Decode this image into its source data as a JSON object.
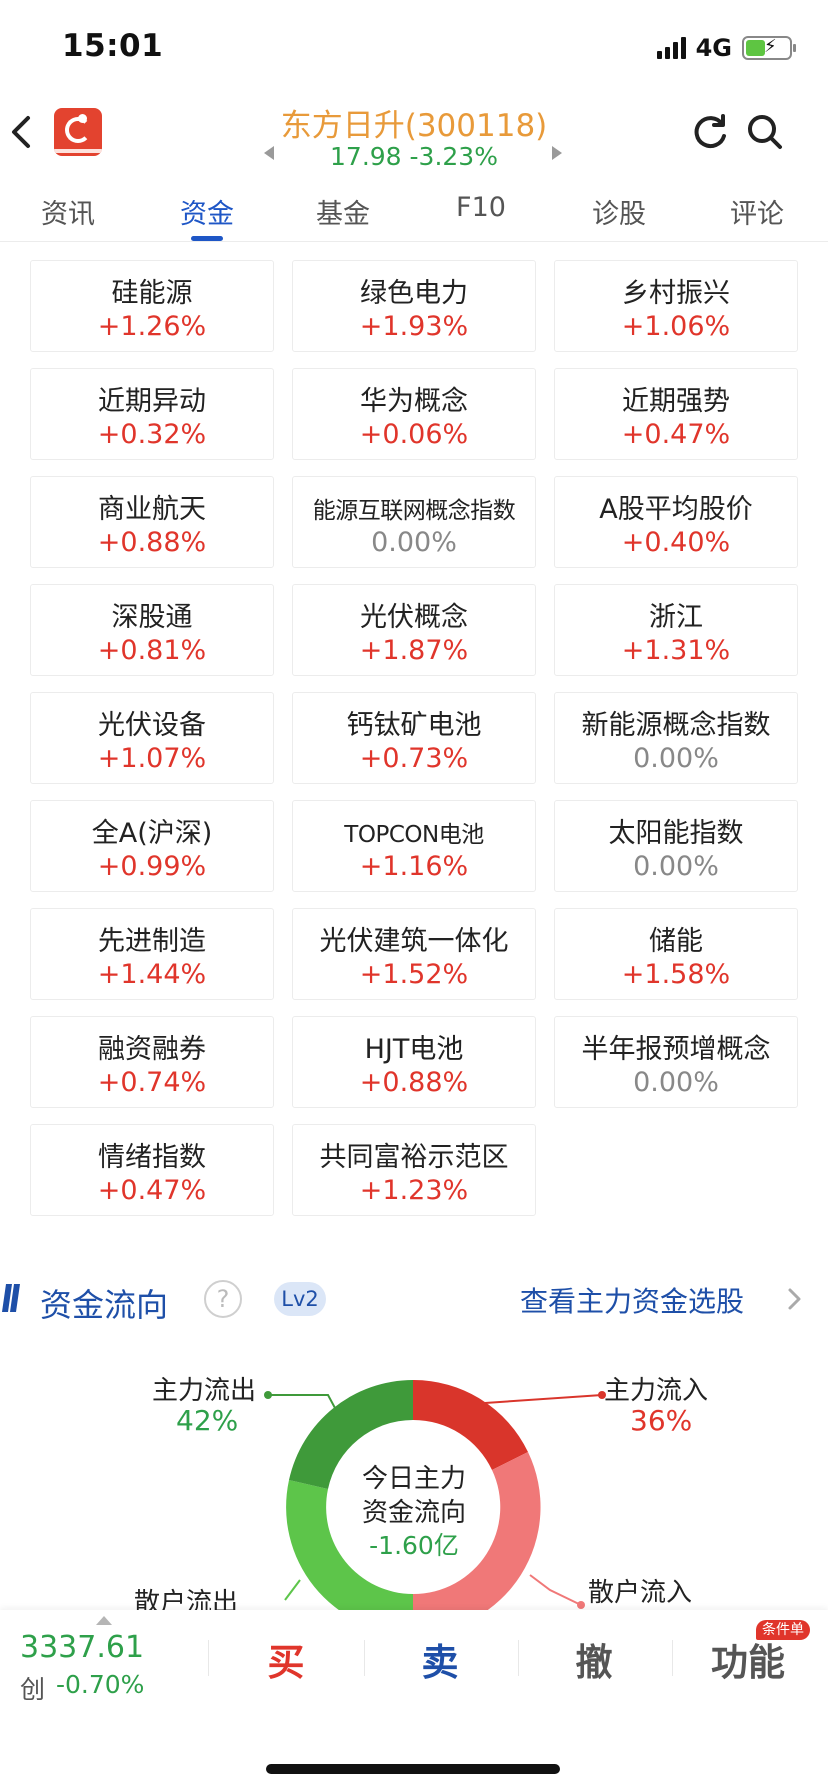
{
  "status_bar": {
    "time": "15:01",
    "network": "4G"
  },
  "header": {
    "stock_title": "东方日升(300118)",
    "stock_quote": "17.98  -3.23%",
    "colors": {
      "title": "#e89a3a",
      "quote": "#2ea04a"
    }
  },
  "tabs": [
    {
      "label": "资讯",
      "active": false
    },
    {
      "label": "资金",
      "active": true
    },
    {
      "label": "基金",
      "active": false
    },
    {
      "label": "F10",
      "active": false
    },
    {
      "label": "诊股",
      "active": false
    },
    {
      "label": "评论",
      "active": false
    }
  ],
  "concepts": [
    {
      "name": "硅能源",
      "change": "+1.26%"
    },
    {
      "name": "绿色电力",
      "change": "+1.93%"
    },
    {
      "name": "乡村振兴",
      "change": "+1.06%"
    },
    {
      "name": "近期异动",
      "change": "+0.32%"
    },
    {
      "name": "华为概念",
      "change": "+0.06%"
    },
    {
      "name": "近期强势",
      "change": "+0.47%"
    },
    {
      "name": "商业航天",
      "change": "+0.88%"
    },
    {
      "name": "能源互联网概念指数",
      "change": "0.00%"
    },
    {
      "name": "A股平均股价",
      "change": "+0.40%"
    },
    {
      "name": "深股通",
      "change": "+0.81%"
    },
    {
      "name": "光伏概念",
      "change": "+1.87%"
    },
    {
      "name": "浙江",
      "change": "+1.31%"
    },
    {
      "name": "光伏设备",
      "change": "+1.07%"
    },
    {
      "name": "钙钛矿电池",
      "change": "+0.73%"
    },
    {
      "name": "新能源概念指数",
      "change": "0.00%"
    },
    {
      "name": "全A(沪深)",
      "change": "+0.99%"
    },
    {
      "name": "TOPCON电池",
      "change": "+1.16%"
    },
    {
      "name": "太阳能指数",
      "change": "0.00%"
    },
    {
      "name": "先进制造",
      "change": "+1.44%"
    },
    {
      "name": "光伏建筑一体化",
      "change": "+1.52%"
    },
    {
      "name": "储能",
      "change": "+1.58%"
    },
    {
      "name": "融资融券",
      "change": "+0.74%"
    },
    {
      "name": "HJT电池",
      "change": "+0.88%"
    },
    {
      "name": "半年报预增概念",
      "change": "0.00%"
    },
    {
      "name": "情绪指数",
      "change": "+0.47%"
    },
    {
      "name": "共同富裕示范区",
      "change": "+1.23%"
    }
  ],
  "money_flow": {
    "title": "资金流向",
    "help_symbol": "?",
    "level_badge": "Lv2",
    "link": "查看主力资金选股",
    "center": {
      "line1": "今日主力",
      "line2": "资金流向",
      "value": "-1.60亿"
    },
    "main_out": {
      "label": "主力流出",
      "pct": "42%"
    },
    "main_in": {
      "label": "主力流入",
      "pct": "36%"
    },
    "retail_out": {
      "label": "散户流出"
    },
    "retail_in": {
      "label": "散户流入"
    },
    "colors": {
      "main_out": "#3f9a3a",
      "retail_out": "#5dc54a",
      "main_in": "#d9352b",
      "retail_in": "#f07878"
    }
  },
  "trade_bar": {
    "index_value": "3337.61",
    "index_name": "创",
    "index_change": "-0.70%",
    "buy": "买",
    "sell": "卖",
    "cancel": "撤",
    "function": "功能",
    "function_badge": "条件单"
  }
}
